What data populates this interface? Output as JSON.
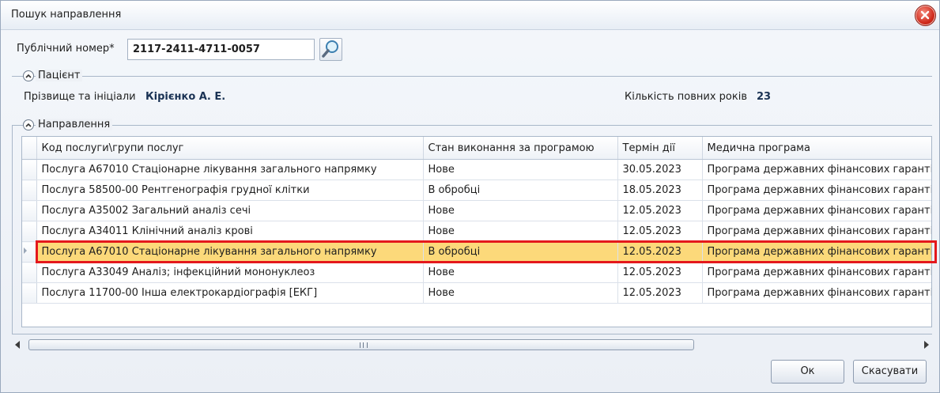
{
  "window": {
    "title": "Пошук направлення"
  },
  "search": {
    "label": "Публічний номер*",
    "value": "2117-2411-4711-0057"
  },
  "patient": {
    "group_title": "Пацієнт",
    "name_label": "Прізвище та ініціали",
    "name_value": "Кірієнко А. Е.",
    "age_label": "Кількість повних років",
    "age_value": "23"
  },
  "referrals": {
    "group_title": "Направлення",
    "columns": [
      "Код послуги\\групи послуг",
      "Стан виконання за програмою",
      "Термін дії",
      "Медична програма"
    ],
    "rows": [
      [
        "Послуга А67010 Стаціонарне лікування загального напрямку",
        "Нове",
        "30.05.2023",
        "Програма державних фінансових гарантій"
      ],
      [
        "Послуга 58500-00 Рентгенографія грудної клітки",
        "В обробці",
        "18.05.2023",
        "Програма державних фінансових гарантій"
      ],
      [
        "Послуга А35002 Загальний аналіз сечі",
        "Нове",
        "12.05.2023",
        "Програма державних фінансових гарантій"
      ],
      [
        "Послуга А34011 Клінічний аналіз крові",
        "Нове",
        "12.05.2023",
        "Програма державних фінансових гарантій"
      ],
      [
        "Послуга А67010 Стаціонарне лікування загального напрямку",
        "В обробці",
        "12.05.2023",
        "Програма державних фінансових гарантій"
      ],
      [
        "Послуга А33049 Аналіз; інфекційний мононуклеоз",
        "Нове",
        "12.05.2023",
        "Програма державних фінансових гарантій"
      ],
      [
        "Послуга 11700-00 Інша електрокардіографія [ЕКГ]",
        "Нове",
        "12.05.2023",
        "Програма державних фінансових гарантій"
      ]
    ],
    "selected_row": 4
  },
  "buttons": {
    "ok": "Ок",
    "cancel": "Скасувати"
  },
  "colors": {
    "selection": "#fcd97a",
    "highlight_frame": "#e4181c"
  }
}
